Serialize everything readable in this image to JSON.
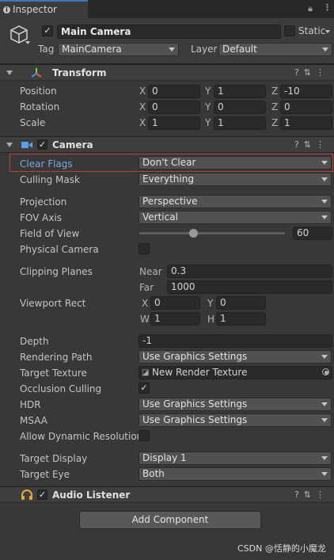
{
  "tab": {
    "title": "Inspector"
  },
  "gameobject": {
    "name": "Main Camera",
    "static_label": "Static",
    "tag_label": "Tag",
    "tag_value": "MainCamera",
    "layer_label": "Layer",
    "layer_value": "Default"
  },
  "transform": {
    "title": "Transform",
    "rows": [
      {
        "label": "Position",
        "x": "0",
        "y": "1",
        "z": "-10"
      },
      {
        "label": "Rotation",
        "x": "0",
        "y": "0",
        "z": "0"
      },
      {
        "label": "Scale",
        "x": "1",
        "y": "1",
        "z": "1"
      }
    ]
  },
  "camera": {
    "title": "Camera",
    "clear_flags": {
      "label": "Clear Flags",
      "value": "Don't Clear"
    },
    "culling_mask": {
      "label": "Culling Mask",
      "value": "Everything"
    },
    "projection": {
      "label": "Projection",
      "value": "Perspective"
    },
    "fov_axis": {
      "label": "FOV Axis",
      "value": "Vertical"
    },
    "field_of_view": {
      "label": "Field of View",
      "value": "60",
      "slider_fraction": 0.37
    },
    "physical_camera": {
      "label": "Physical Camera"
    },
    "clipping": {
      "label": "Clipping Planes",
      "near_label": "Near",
      "near": "0.3",
      "far_label": "Far",
      "far": "1000"
    },
    "viewport": {
      "label": "Viewport Rect",
      "x_label": "X",
      "x": "0",
      "y_label": "Y",
      "y": "0",
      "w_label": "W",
      "w": "1",
      "h_label": "H",
      "h": "1"
    },
    "depth": {
      "label": "Depth",
      "value": "-1"
    },
    "rendering_path": {
      "label": "Rendering Path",
      "value": "Use Graphics Settings"
    },
    "target_texture": {
      "label": "Target Texture",
      "value": "New Render Texture"
    },
    "occlusion": {
      "label": "Occlusion Culling"
    },
    "hdr": {
      "label": "HDR",
      "value": "Use Graphics Settings"
    },
    "msaa": {
      "label": "MSAA",
      "value": "Use Graphics Settings"
    },
    "dynamic_res": {
      "label": "Allow Dynamic Resolution"
    },
    "target_display": {
      "label": "Target Display",
      "value": "Display 1"
    },
    "target_eye": {
      "label": "Target Eye",
      "value": "Both"
    }
  },
  "audio_listener": {
    "title": "Audio Listener"
  },
  "add_component": {
    "label": "Add Component"
  },
  "axis_labels": {
    "x": "X",
    "y": "Y",
    "z": "Z"
  },
  "watermark": "CSDN @恬静的小魔龙",
  "colors": {
    "highlight_border": "#c8383c",
    "label_blue": "#7ba7e0",
    "tab_accent": "#3a79bb"
  }
}
